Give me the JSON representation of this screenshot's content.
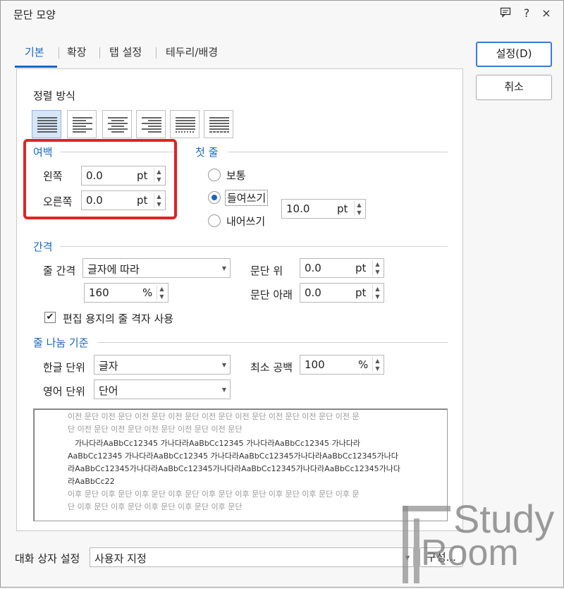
{
  "window": {
    "title": "문단 모양",
    "comment_icon": "comment-icon",
    "help_label": "?",
    "close_label": "×"
  },
  "tabs": [
    {
      "label": "기본",
      "active": true
    },
    {
      "label": "확장",
      "active": false
    },
    {
      "label": "탭 설정",
      "active": false
    },
    {
      "label": "테두리/배경",
      "active": false
    }
  ],
  "buttons": {
    "ok": "설정(D)",
    "cancel": "취소",
    "compose": "구성..."
  },
  "alignment": {
    "label": "정렬 방식",
    "options": [
      "justify",
      "left",
      "center",
      "right",
      "distribute",
      "divide"
    ],
    "selected": "justify"
  },
  "margin": {
    "label": "여백",
    "left_label": "왼쪽",
    "left_value": "0.0",
    "right_label": "오른쪽",
    "right_value": "0.0",
    "unit": "pt"
  },
  "first_line": {
    "label": "첫 줄",
    "normal": "보통",
    "indent": "들여쓰기",
    "outdent": "내어쓰기",
    "selected": "indent",
    "value": "10.0",
    "unit": "pt"
  },
  "spacing": {
    "label": "간격",
    "line_spacing_label": "줄 간격",
    "line_spacing_type": "글자에 따라",
    "line_spacing_value": "160",
    "line_spacing_unit": "%",
    "above_label": "문단 위",
    "above_value": "0.0",
    "below_label": "문단 아래",
    "below_value": "0.0",
    "unit": "pt",
    "grid_checkbox_label": "편집 용지의 줄 격자 사용",
    "grid_checked": true
  },
  "line_break": {
    "label": "줄 나눔 기준",
    "korean_label": "한글 단위",
    "korean_value": "글자",
    "english_label": "영어 단위",
    "english_value": "단어",
    "min_space_label": "최소 공백",
    "min_space_value": "100",
    "min_space_unit": "%"
  },
  "preview": {
    "prev_line1": "이전 문단 이전 문단 이전 문단 이전 문단 이전 문단 이전 문단 이전 문단 이전 문단 이전 문",
    "prev_line2": "단 이전 문단 이전 문단 이전 문단 이전 문단 이전 문단",
    "cur_line1": "가나다라AaBbCc12345 가나다라AaBbCc12345 가나다라AaBbCc12345 가나다라",
    "cur_line2": "AaBbCc12345 가나다라AaBbCc12345 가나다라AaBbCc12345가나다라AaBbCc12345가나다",
    "cur_line3": "라AaBbCc12345가나다라AaBbCc12345가나다라AaBbCc12345가나다라AaBbCc12345가나다",
    "cur_line4": "라AaBbCc22",
    "next_line1": "이후 문단 이후 문단 이후 문단 이후 문단 이후 문단 이후 문단 이후 문단 이후 문단 이후 문",
    "next_line2": "단 이후 문단 이후 문단 이후 문단 이후 문단 이후 문단"
  },
  "footer": {
    "dialog_settings_label": "대화 상자 설정",
    "dialog_settings_value": "사용자 지정"
  },
  "watermark": {
    "line1": "Study",
    "line2": "Room"
  },
  "colors": {
    "accent": "#1a66c2",
    "highlight": "#e02424"
  }
}
